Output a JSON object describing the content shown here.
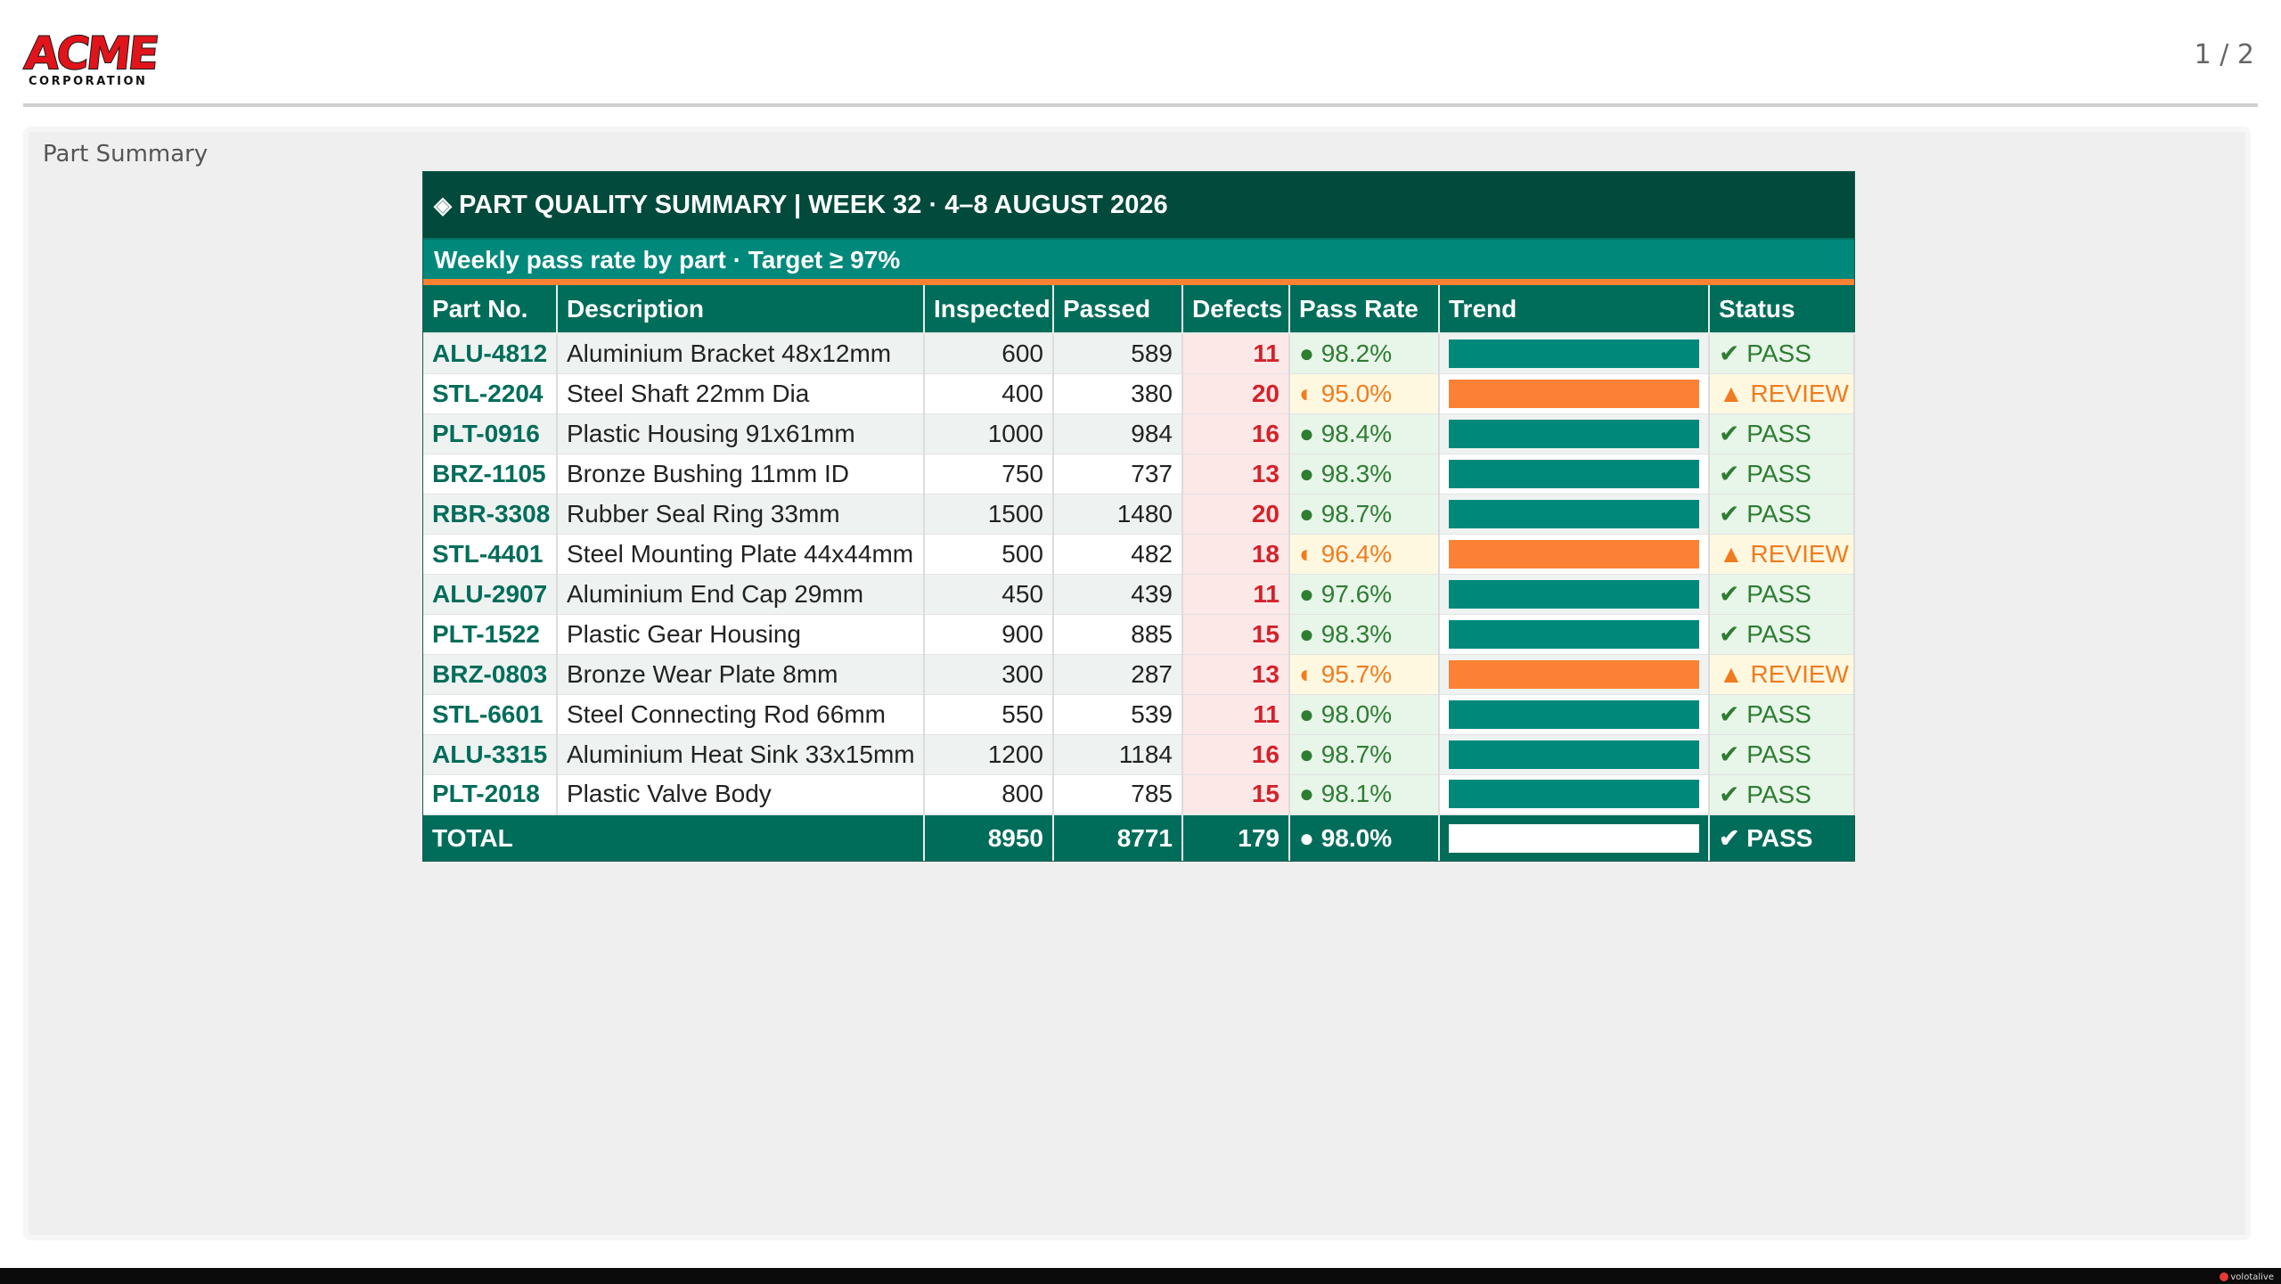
{
  "header": {
    "logo_main": "ACME",
    "logo_sub": "CORPORATION",
    "page_indicator": "1 / 2"
  },
  "panel": {
    "title": "Part Summary"
  },
  "report": {
    "title": "PART QUALITY SUMMARY | WEEK 32 · 4–8 AUGUST 2026",
    "title_icon": "◈",
    "subtitle": "Weekly pass rate by part · Target ≥ 97%",
    "columns": [
      "Part No.",
      "Description",
      "Inspected",
      "Passed",
      "Defects",
      "Pass Rate",
      "Trend",
      "Status"
    ],
    "rows": [
      {
        "part": "ALU-4812",
        "description": "Aluminium Bracket 48x12mm",
        "inspected": "600",
        "passed": "589",
        "defects": "11",
        "rate_icon": "●",
        "rate": "98.2%",
        "status_icon": "✔",
        "status": "PASS",
        "state": "pass",
        "trend": 0.982
      },
      {
        "part": "STL-2204",
        "description": "Steel Shaft 22mm Dia",
        "inspected": "400",
        "passed": "380",
        "defects": "20",
        "rate_icon": "◐",
        "rate": "95.0%",
        "status_icon": "▲",
        "status": "REVIEW",
        "state": "review",
        "trend": 0.95
      },
      {
        "part": "PLT-0916",
        "description": "Plastic Housing 91x61mm",
        "inspected": "1000",
        "passed": "984",
        "defects": "16",
        "rate_icon": "●",
        "rate": "98.4%",
        "status_icon": "✔",
        "status": "PASS",
        "state": "pass",
        "trend": 0.984
      },
      {
        "part": "BRZ-1105",
        "description": "Bronze Bushing 11mm ID",
        "inspected": "750",
        "passed": "737",
        "defects": "13",
        "rate_icon": "●",
        "rate": "98.3%",
        "status_icon": "✔",
        "status": "PASS",
        "state": "pass",
        "trend": 0.983
      },
      {
        "part": "RBR-3308",
        "description": "Rubber Seal Ring 33mm",
        "inspected": "1500",
        "passed": "1480",
        "defects": "20",
        "rate_icon": "●",
        "rate": "98.7%",
        "status_icon": "✔",
        "status": "PASS",
        "state": "pass",
        "trend": 0.987
      },
      {
        "part": "STL-4401",
        "description": "Steel Mounting Plate 44x44mm",
        "inspected": "500",
        "passed": "482",
        "defects": "18",
        "rate_icon": "◐",
        "rate": "96.4%",
        "status_icon": "▲",
        "status": "REVIEW",
        "state": "review",
        "trend": 0.964
      },
      {
        "part": "ALU-2907",
        "description": "Aluminium End Cap 29mm",
        "inspected": "450",
        "passed": "439",
        "defects": "11",
        "rate_icon": "●",
        "rate": "97.6%",
        "status_icon": "✔",
        "status": "PASS",
        "state": "pass",
        "trend": 0.976
      },
      {
        "part": "PLT-1522",
        "description": "Plastic Gear Housing",
        "inspected": "900",
        "passed": "885",
        "defects": "15",
        "rate_icon": "●",
        "rate": "98.3%",
        "status_icon": "✔",
        "status": "PASS",
        "state": "pass",
        "trend": 0.983
      },
      {
        "part": "BRZ-0803",
        "description": "Bronze Wear Plate 8mm",
        "inspected": "300",
        "passed": "287",
        "defects": "13",
        "rate_icon": "◐",
        "rate": "95.7%",
        "status_icon": "▲",
        "status": "REVIEW",
        "state": "review",
        "trend": 0.957
      },
      {
        "part": "STL-6601",
        "description": "Steel Connecting Rod 66mm",
        "inspected": "550",
        "passed": "539",
        "defects": "11",
        "rate_icon": "●",
        "rate": "98.0%",
        "status_icon": "✔",
        "status": "PASS",
        "state": "pass",
        "trend": 0.98
      },
      {
        "part": "ALU-3315",
        "description": "Aluminium Heat Sink 33x15mm",
        "inspected": "1200",
        "passed": "1184",
        "defects": "16",
        "rate_icon": "●",
        "rate": "98.7%",
        "status_icon": "✔",
        "status": "PASS",
        "state": "pass",
        "trend": 0.987
      },
      {
        "part": "PLT-2018",
        "description": "Plastic Valve Body",
        "inspected": "800",
        "passed": "785",
        "defects": "15",
        "rate_icon": "●",
        "rate": "98.1%",
        "status_icon": "✔",
        "status": "PASS",
        "state": "pass",
        "trend": 0.981
      }
    ],
    "total": {
      "label": "TOTAL",
      "inspected": "8950",
      "passed": "8771",
      "defects": "179",
      "rate_icon": "●",
      "rate": "98.0%",
      "status_icon": "✔",
      "status": "PASS",
      "trend": 0.98
    },
    "colors": {
      "teal": "#00897b",
      "orange": "#fb8234",
      "dark_green": "#014a3c",
      "defect_red": "#d3222a"
    }
  },
  "footer": {
    "brand": "volotalive"
  }
}
